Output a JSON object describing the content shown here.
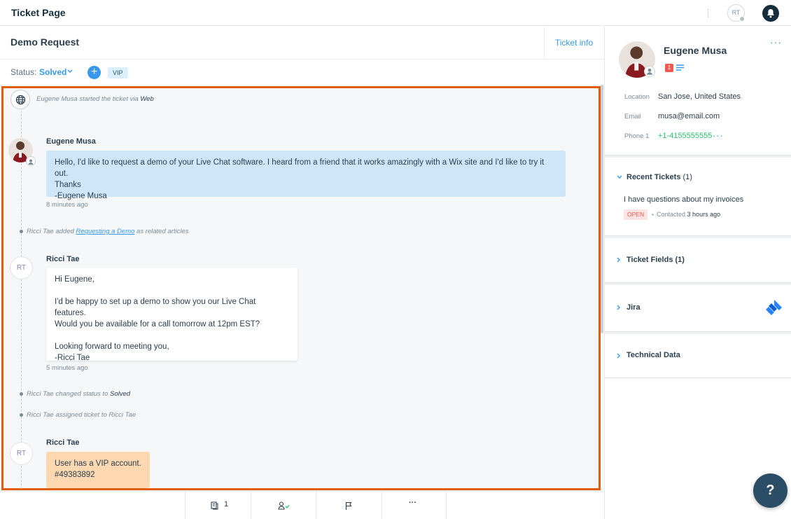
{
  "topbar": {
    "title": "Ticket Page",
    "agent_initials": "RT"
  },
  "ticket": {
    "name": "Demo Request",
    "info_button": "Ticket info",
    "status_label": "Status:",
    "status_value": "Solved",
    "tag": "VIP"
  },
  "conversation": {
    "start_event": {
      "actor": "Eugene Musa",
      "text": "started the ticket via",
      "channel": "Web"
    },
    "messages": [
      {
        "author": "Eugene Musa",
        "body": "Hello, I'd like to request a demo of your Live Chat software. I heard from a friend that it works amazingly with a Wix site and I'd like to try it out.\nThanks\n-Eugene Musa",
        "time": "8 minutes ago"
      },
      {
        "author": "Ricci Tae",
        "initials": "RT",
        "body": "Hi Eugene,\n\nI'd be happy to set up a demo to show you our Live Chat features.\nWould you be available for a call tomorrow at 12pm EST?\n\nLooking forward to meeting you,\n-Ricci Tae",
        "time": "5 minutes ago"
      },
      {
        "author": "Ricci Tae",
        "initials": "RT",
        "body": "User has a VIP account.\n#49383892"
      }
    ],
    "events": [
      {
        "prefix": "Ricci Tae added",
        "link": "Requesting a Demo",
        "suffix": "as related articles"
      },
      {
        "prefix": "Ricci Tae changed status to",
        "value": "Solved"
      },
      {
        "prefix": "Ricci Tae assigned ticket to Ricci Tae"
      }
    ]
  },
  "toolbar": {
    "articles_count": "1",
    "more": "···"
  },
  "customer": {
    "name": "Eugene Musa",
    "badge_count": "1",
    "location_label": "Location",
    "location": "San Jose, United States",
    "email_label": "Email",
    "email": "musa@email.com",
    "phone_label": "Phone 1",
    "phone": "+1-4155555555"
  },
  "sections": {
    "recent_tickets": {
      "title": "Recent Tickets",
      "count": "(1)",
      "item": {
        "subject": "I have questions about my invoices",
        "status": "OPEN",
        "contacted_label": "Contacted",
        "contacted_time": "3 hours ago"
      }
    },
    "ticket_fields": {
      "title": "Ticket Fields (1)"
    },
    "jira": {
      "title": "Jira"
    },
    "technical_data": {
      "title": "Technical Data"
    }
  },
  "help_button": "?",
  "colors": {
    "accent": "#3899ec",
    "highlight_frame": "#e05d0b",
    "dark": "#162d3d",
    "success": "#27c26a"
  }
}
